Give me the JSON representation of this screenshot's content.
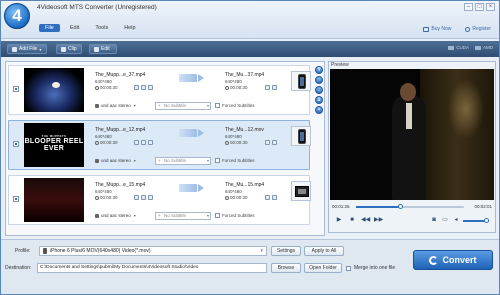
{
  "window": {
    "logo": "4",
    "title": "4Videosoft MTS Converter (Unregistered)",
    "controls": [
      "–",
      "□",
      "×"
    ]
  },
  "menu": {
    "items": [
      "File",
      "Edit",
      "Tools",
      "Help"
    ],
    "active": "File"
  },
  "top_links": {
    "buy_now": "Buy Now",
    "register": "Register"
  },
  "toolbar": {
    "add_file": "Add File",
    "clip": "Clip",
    "edit": "Edit",
    "cuda": "CUDA",
    "amd": "AMD"
  },
  "files": [
    {
      "src_name": "The_Mupp...e_37.mp4",
      "src_res": "640*480",
      "src_dur": "00:00:30",
      "dst_name": "The_Mu...37.mp4",
      "dst_res": "640*480",
      "dst_dur": "00:00:30",
      "audio": "und aac stereo",
      "subtitle": "No Subtitle",
      "forced": "Forced Subtitles",
      "device_icon": "media-player-icon",
      "thumb": "night-scene"
    },
    {
      "src_name": "The_Mupp...e_12.mp4",
      "src_res": "640*480",
      "src_dur": "00:00:30",
      "dst_name": "The_Mu...12.mov",
      "dst_res": "640*480",
      "dst_dur": "00:00:30",
      "audio": "und aac stereo",
      "subtitle": "No Subtitle",
      "forced": "Forced Subtitles",
      "device_icon": "phone-icon",
      "thumb": "title-card",
      "thumb_text_top": "THE MUPPETS",
      "thumb_text_main": "BLOOPER REEL EVER"
    },
    {
      "src_name": "The_Mupp...e_15.mp4",
      "src_res": "640*480",
      "src_dur": "00:00:30",
      "dst_name": "The_Mu...15.mp4",
      "dst_res": "640*480",
      "dst_dur": "00:00:30",
      "audio": "und aac stereo",
      "subtitle": "No Subtitle",
      "forced": "Forced Subtitles",
      "device_icon": "film-icon",
      "thumb": "dark-red"
    }
  ],
  "preview": {
    "label": "Preview",
    "current_time": "00:01:25",
    "total_time": "00:02:01",
    "progress": 0.42
  },
  "bottom": {
    "profile_label": "Profile:",
    "profile_value": "iPhone 6 Plus/6 MOV(640x480) Video(*.mov)",
    "settings": "Settings",
    "apply_all": "Apply to All",
    "dest_label": "Destination:",
    "dest_value": "C:\\Documents and Settings\\pubmi\\My Documents\\4Videosoft Studio\\Video",
    "browse": "Browse",
    "open_folder": "Open Folder",
    "merge": "Merge into one file",
    "convert": "Convert"
  },
  "colors": {
    "accent": "#2f6fc0",
    "toolbar": "#3e5f88",
    "selected_row": "#dceaf8"
  }
}
